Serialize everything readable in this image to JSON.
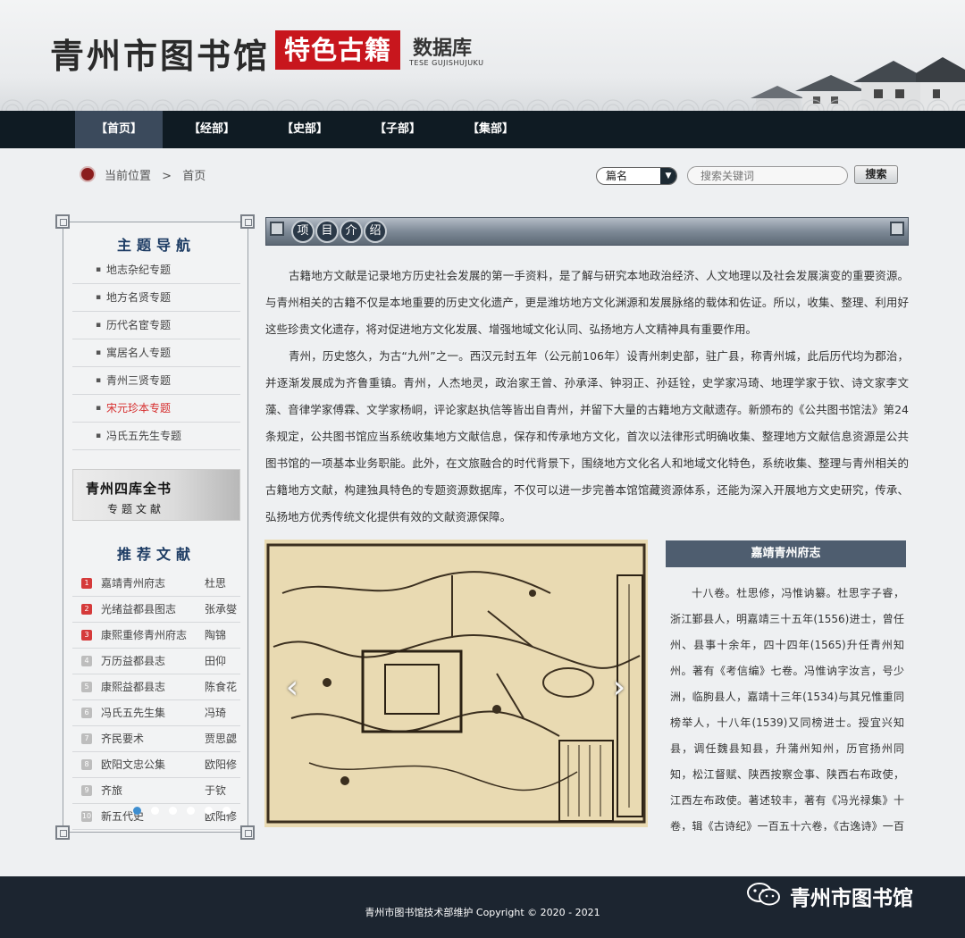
{
  "header": {
    "library_name": "青州市图书馆",
    "special_label": "特色古籍",
    "database_label": "数据库",
    "pinyin": "TESE GUJISHUJUKU"
  },
  "nav": [
    "【首页】",
    "【经部】",
    "【史部】",
    "【子部】",
    "【集部】"
  ],
  "breadcrumb": {
    "location": "当前位置",
    "separator": ">",
    "current": "首页"
  },
  "search": {
    "select_value": "篇名",
    "placeholder": "搜索关键词",
    "button": "搜索"
  },
  "sidebar": {
    "topic_heading": "主题导航",
    "topics": [
      "地志杂纪专题",
      "地方名贤专题",
      "历代名宦专题",
      "寓居名人专题",
      "青州三贤专题",
      "宋元珍本专题",
      "冯氏五先生专题"
    ],
    "banner": {
      "title": "青州四库全书",
      "subtitle": "专题文献"
    },
    "rec_heading": "推荐文献",
    "recommended": [
      {
        "num": "1",
        "title": "嘉靖青州府志",
        "author": "杜思"
      },
      {
        "num": "2",
        "title": "光绪益都县图志",
        "author": "张承燮"
      },
      {
        "num": "3",
        "title": "康熙重修青州府志",
        "author": "陶锦"
      },
      {
        "num": "4",
        "title": "万历益都县志",
        "author": "田仰"
      },
      {
        "num": "5",
        "title": "康熙益都县志",
        "author": "陈食花"
      },
      {
        "num": "6",
        "title": "冯氏五先生集",
        "author": "冯琦"
      },
      {
        "num": "7",
        "title": "齐民要术",
        "author": "贾思勰"
      },
      {
        "num": "8",
        "title": "欧阳文忠公集",
        "author": "欧阳修"
      },
      {
        "num": "9",
        "title": "齐旅",
        "author": "于钦"
      },
      {
        "num": "10",
        "title": "新五代史",
        "author": "欧阳修"
      }
    ]
  },
  "main": {
    "section_title": [
      "项",
      "目",
      "介",
      "绍"
    ],
    "intro_p1": "古籍地方文献是记录地方历史社会发展的第一手资料，是了解与研究本地政治经济、人文地理以及社会发展演变的重要资源。与青州相关的古籍不仅是本地重要的历史文化遗产，更是潍坊地方文化渊源和发展脉络的载体和佐证。所以，收集、整理、利用好这些珍贵文化遗存，将对促进地方文化发展、增强地域文化认同、弘扬地方人文精神具有重要作用。",
    "intro_p2": "青州，历史悠久，为古“九州”之一。西汉元封五年（公元前106年）设青州刺史部，驻广县，称青州城，此后历代均为郡治，并逐渐发展成为齐鲁重镇。青州，人杰地灵，政治家王曾、孙承泽、钟羽正、孙廷铨，史学家冯琦、地理学家于钦、诗文家李文藻、音律学家傅霖、文学家杨峒，评论家赵执信等皆出自青州，并留下大量的古籍地方文献遗存。新颁布的《公共图书馆法》第24条规定，公共图书馆应当系统收集地方文献信息，保存和传承地方文化，首次以法律形式明确收集、整理地方文献信息资源是公共图书馆的一项基本业务职能。此外，在文旅融合的时代背景下，围绕地方文化名人和地域文化特色，系统收集、整理与青州相关的古籍地方文献，构建独具特色的专题资源数据库，不仅可以进一步完善本馆馆藏资源体系，还能为深入开展地方文史研究，传承、弘扬地方优秀传统文化提供有效的文献资源保障。",
    "carousel": {
      "prev": "‹",
      "next": "›",
      "dots": 6,
      "active_dot": 1
    },
    "detail": {
      "title": "嘉靖青州府志",
      "text": "十八卷。杜思修，冯惟讷纂。杜思字子睿，浙江鄞县人，明嘉靖三十五年(1556)进士，曾任州、县事十余年，四十四年(1565)升任青州知州。著有《考信编》七卷。冯惟讷字汝言，号少洲，临朐县人，嘉靖十三年(1534)与其兄惟重同榜举人，十八年(1539)又同榜进士。授宜兴知县，调任魏县知县，升蒲州知州，历官扬州同知，松江督赋、陕西按察佥事、陕西右布政使，江西左布政使。著述较丰，著有《冯光禄集》十卷，辑《古诗纪》一百五十六卷，《古逸诗》一百三十卷等。按青州，自隋、唐以来治益都，元"
    }
  },
  "footer": {
    "copyright": "青州市图书馆技术部维护 Copyright © 2020 - 2021",
    "wechat_name": "青州市图书馆"
  },
  "colors": {
    "nav_bg": "#0f1b23",
    "nav_active": "#3b4a5c",
    "accent_red": "#c8161d",
    "footer_bg": "#1c2530"
  }
}
